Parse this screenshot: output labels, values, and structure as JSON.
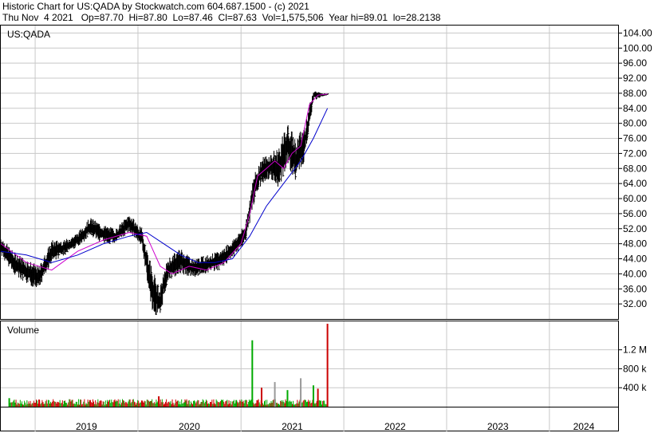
{
  "header": {
    "line1": "Historic Chart for US:QADA by Stockwatch.com 604.687.1500 - (c) 2021",
    "line2": "Thu Nov  4 2021   Op=87.70  Hi=87.80  Lo=87.46  Cl=87.63  Vol=1,575,506  Year hi=89.01  lo=28.2138"
  },
  "colors": {
    "price_bar": "#000000",
    "ma_short": "#cc00cc",
    "ma_long": "#0000cc",
    "volume_up": "#00aa00",
    "volume_down": "#cc0000",
    "volume_neutral": "#999999",
    "grid": "#c8c8c8"
  },
  "chart_data": [
    {
      "type": "line",
      "title": "US:QADA",
      "xlabel": "",
      "ylabel": "",
      "ylim": [
        28,
        106
      ],
      "yticks": [
        "104.00",
        "100.00",
        "96.00",
        "92.00",
        "88.00",
        "84.00",
        "80.00",
        "76.00",
        "72.00",
        "68.00",
        "64.00",
        "60.00",
        "56.00",
        "52.00",
        "48.00",
        "44.00",
        "40.00",
        "36.00",
        "32.00"
      ],
      "ytick_values": [
        104,
        100,
        96,
        92,
        88,
        84,
        80,
        76,
        72,
        68,
        64,
        60,
        56,
        52,
        48,
        44,
        40,
        36,
        32
      ],
      "x_range": [
        "2018-09-01",
        "2024-09-01"
      ],
      "xticks": [
        "2019",
        "2020",
        "2021",
        "2022",
        "2023",
        "2024"
      ],
      "grid": true,
      "series": [
        {
          "kind": "price",
          "x": [
            "2018-09-01",
            "2018-10-15",
            "2018-12-01",
            "2019-01-15",
            "2019-03-01",
            "2019-04-15",
            "2019-06-01",
            "2019-07-15",
            "2019-09-01",
            "2019-10-15",
            "2019-12-01",
            "2020-01-15",
            "2020-02-20",
            "2020-03-18",
            "2020-04-15",
            "2020-06-01",
            "2020-07-15",
            "2020-09-01",
            "2020-10-15",
            "2020-12-01",
            "2021-01-15",
            "2021-02-15",
            "2021-03-15",
            "2021-04-15",
            "2021-05-15",
            "2021-06-15",
            "2021-07-15",
            "2021-08-15",
            "2021-09-15",
            "2021-10-15",
            "2021-11-04"
          ],
          "high": [
            50,
            46,
            44,
            42,
            49,
            49,
            51,
            55,
            53,
            52,
            56,
            52,
            42,
            36,
            44,
            47,
            44,
            45,
            46,
            49,
            53,
            66,
            71,
            72,
            74,
            80,
            76,
            80,
            89,
            88,
            88
          ],
          "low": [
            45,
            40,
            37,
            36,
            43,
            45,
            47,
            50,
            48,
            48,
            51,
            47,
            30,
            28,
            38,
            40,
            39,
            40,
            41,
            44,
            48,
            58,
            64,
            65,
            62,
            69,
            64,
            70,
            86,
            87,
            87.5
          ],
          "close": [
            47,
            42,
            40,
            39,
            47,
            47,
            50,
            52,
            50,
            50,
            53,
            49,
            35,
            33,
            41,
            43,
            41,
            42,
            43,
            47,
            52,
            63,
            68,
            69,
            66,
            75,
            68,
            76,
            87,
            88,
            87.6
          ]
        },
        {
          "kind": "ma_short",
          "x": [
            "2018-09-01",
            "2018-12-01",
            "2019-03-01",
            "2019-06-01",
            "2019-09-01",
            "2019-12-01",
            "2020-02-01",
            "2020-03-20",
            "2020-05-01",
            "2020-07-01",
            "2020-09-01",
            "2020-11-01",
            "2021-01-01",
            "2021-02-01",
            "2021-03-01",
            "2021-04-01",
            "2021-05-01",
            "2021-06-01",
            "2021-07-01",
            "2021-08-01",
            "2021-09-01",
            "2021-10-01",
            "2021-11-04"
          ],
          "values": [
            48,
            43,
            41,
            46,
            49,
            51,
            50,
            42,
            40,
            42,
            41,
            43,
            48,
            56,
            66,
            68,
            70,
            68,
            72,
            74,
            85,
            87.5,
            87.8
          ]
        },
        {
          "kind": "ma_long",
          "x": [
            "2018-09-01",
            "2018-12-01",
            "2019-03-01",
            "2019-06-01",
            "2019-09-01",
            "2019-12-01",
            "2020-02-01",
            "2020-04-01",
            "2020-06-01",
            "2020-08-01",
            "2020-10-01",
            "2020-12-01",
            "2021-02-01",
            "2021-04-01",
            "2021-06-01",
            "2021-08-01",
            "2021-09-15",
            "2021-11-04"
          ],
          "values": [
            46,
            45,
            43,
            45,
            48,
            50,
            51,
            48,
            45,
            43,
            43,
            44,
            50,
            58,
            64,
            70,
            76,
            84
          ]
        }
      ]
    },
    {
      "type": "bar",
      "title": "Volume",
      "ylim": [
        0,
        1800000
      ],
      "yticks": [
        "1.2 M",
        "800 k",
        "400 k"
      ],
      "ytick_values": [
        1200000,
        800000,
        400000
      ],
      "x": [
        "2018-10-01",
        "2019-01-15",
        "2019-04-15",
        "2019-07-15",
        "2019-10-15",
        "2020-01-15",
        "2020-03-15",
        "2020-06-15",
        "2020-09-15",
        "2020-12-15",
        "2021-02-10",
        "2021-03-15",
        "2021-05-01",
        "2021-06-15",
        "2021-08-01",
        "2021-09-15",
        "2021-10-01",
        "2021-11-04"
      ],
      "values": [
        180000,
        150000,
        120000,
        140000,
        110000,
        130000,
        220000,
        90000,
        100000,
        140000,
        1400000,
        400000,
        520000,
        350000,
        600000,
        450000,
        380000,
        1750000
      ],
      "direction": [
        "up",
        "down",
        "up",
        "down",
        "up",
        "down",
        "down",
        "up",
        "down",
        "up",
        "up",
        "down",
        "neutral",
        "up",
        "neutral",
        "up",
        "down",
        "down"
      ]
    }
  ]
}
